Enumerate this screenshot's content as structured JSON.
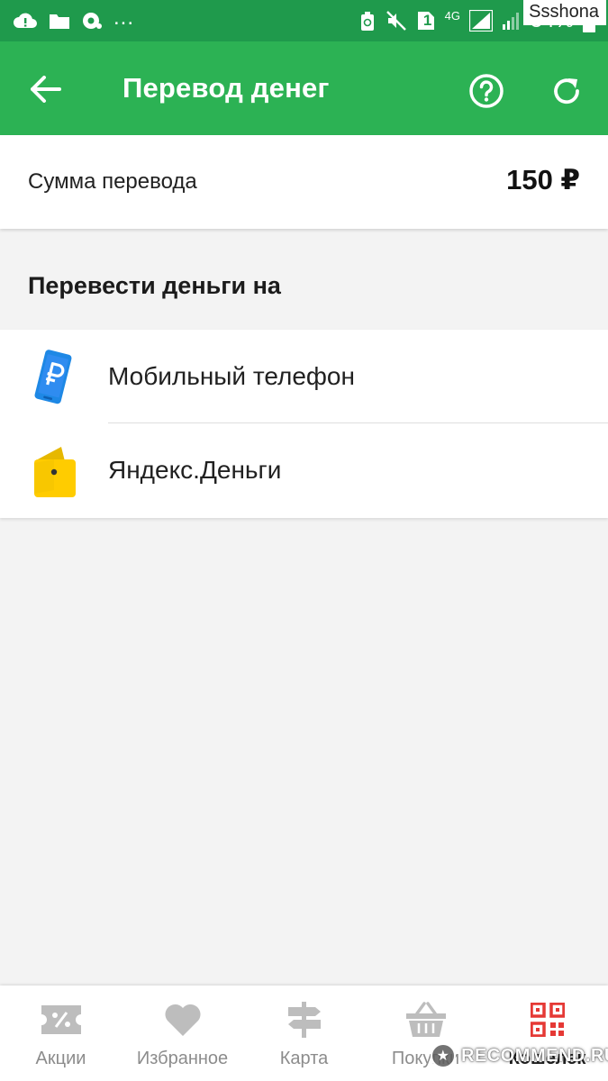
{
  "status_bar": {
    "battery": "54%",
    "network": "4G",
    "sim_slot": "1",
    "overflow": "...",
    "icons": [
      "cloud-alert-icon",
      "folder-icon",
      "chrome-icon",
      "recycle-icon",
      "mute-icon",
      "sim-icon",
      "signal-icon",
      "battery-icon"
    ]
  },
  "watermark": {
    "user": "Ssshona",
    "site": "RECOMMEND.RU"
  },
  "app_bar": {
    "title": "Перевод денег",
    "background": "#2cb254",
    "status_background": "#1f9a4c"
  },
  "amount": {
    "label": "Сумма перевода",
    "value": "150 ₽"
  },
  "section": {
    "title": "Перевести деньги на"
  },
  "transfer_options": [
    {
      "label": "Мобильный телефон",
      "icon": "mobile-ruble-icon"
    },
    {
      "label": "Яндекс.Деньги",
      "icon": "yandex-wallet-icon"
    }
  ],
  "bottom_nav": {
    "items": [
      {
        "label": "Акции",
        "icon": "coupon-percent-icon",
        "active": false
      },
      {
        "label": "Избранное",
        "icon": "heart-icon",
        "active": false
      },
      {
        "label": "Карта",
        "icon": "signpost-icon",
        "active": false
      },
      {
        "label": "Покупки",
        "icon": "basket-icon",
        "active": false
      },
      {
        "label": "Кошелек",
        "icon": "qr-code-icon",
        "active": true
      }
    ],
    "active_color": "#e53935"
  }
}
